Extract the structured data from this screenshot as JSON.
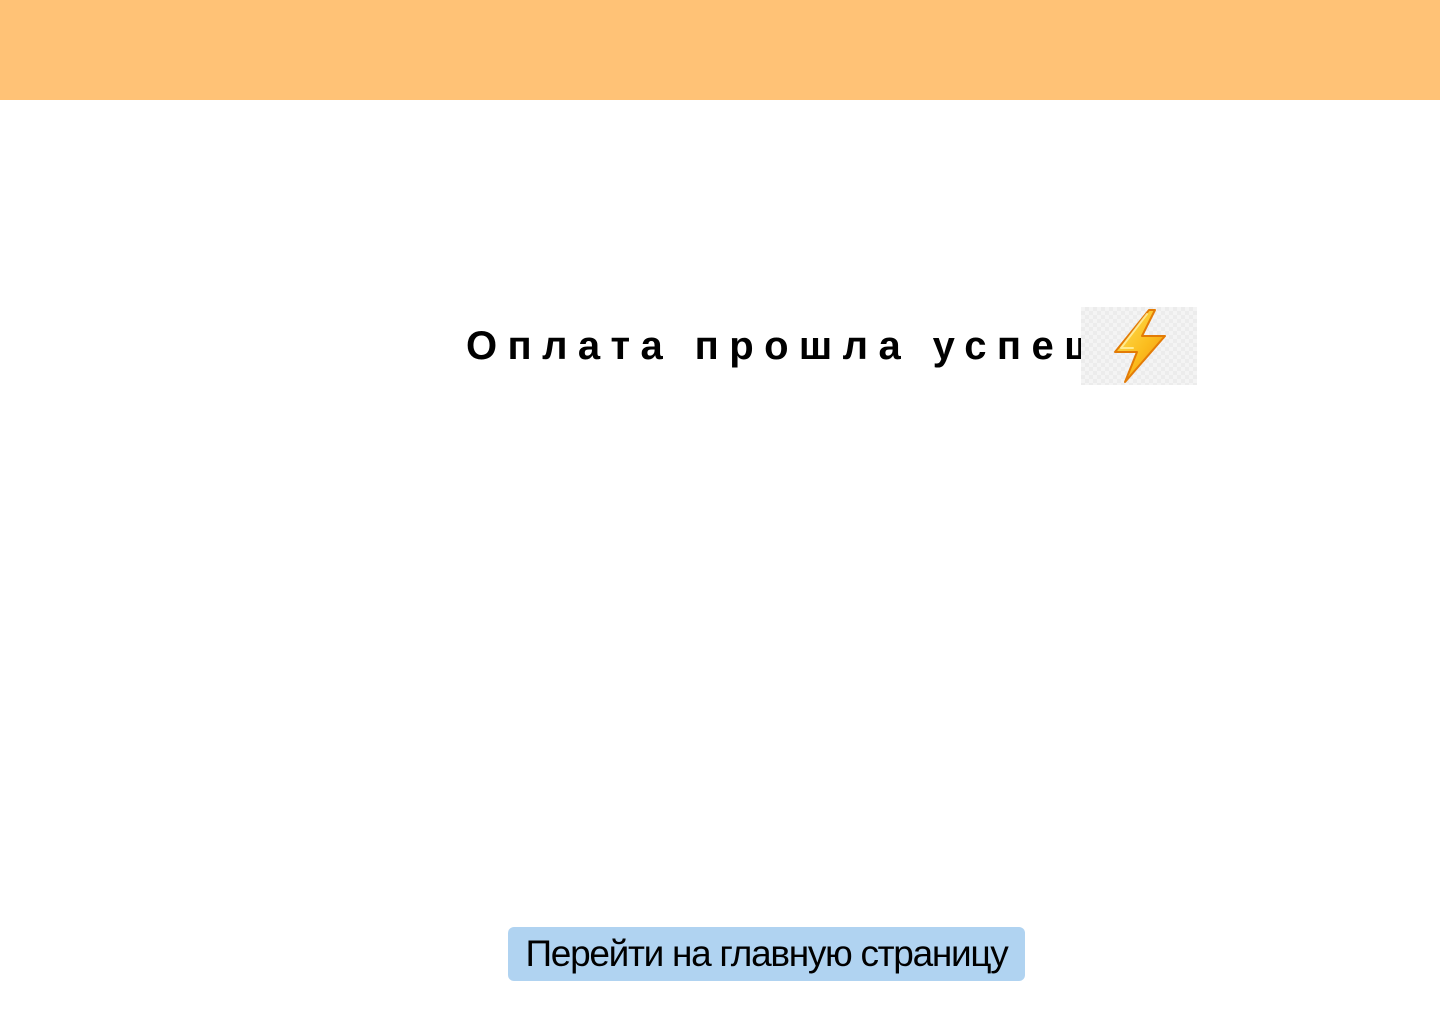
{
  "header": {
    "background": "#ffc276"
  },
  "status": {
    "message": "Оплата прошла успешно",
    "icon": "lightning-icon",
    "icon_colors": [
      "#fdd835",
      "#f57c00"
    ]
  },
  "actions": {
    "home_label": "Перейти на главную страницу",
    "home_button_color": "#b0d3f1"
  }
}
